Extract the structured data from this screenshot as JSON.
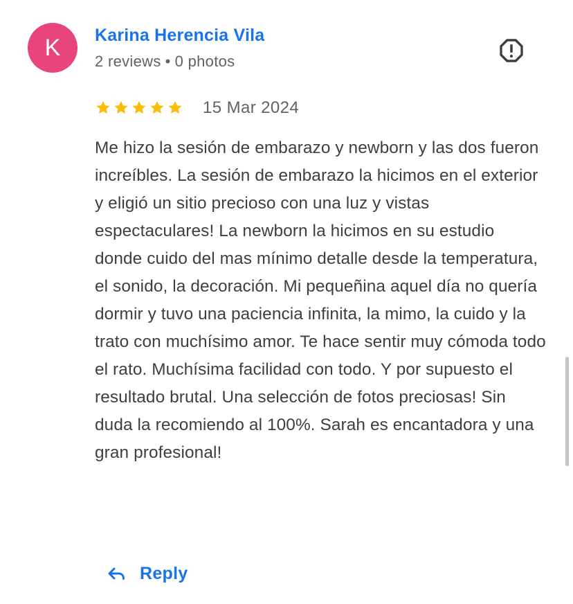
{
  "reviewer": {
    "initial": "K",
    "name": "Karina Herencia Vila",
    "reviews": "2 reviews",
    "separator": "•",
    "photos": "0 photos"
  },
  "review": {
    "rating": 5,
    "rating_max": 5,
    "date": "15 Mar 2024",
    "text": "Me hizo la sesión de embarazo y newborn y las dos fueron increíbles. La sesión de embarazo la hicimos en el exterior y eligió un sitio precioso con una luz y vistas espectaculares! La newborn la hicimos en su estudio donde cuido del mas mínimo detalle desde la temperatura, el sonido, la decoración. Mi pequeñina aquel día no quería dormir y tuvo una paciencia infinita, la mimo, la cuido y la trato con muchísimo amor. Te hace sentir muy cómoda todo el rato. Muchísima facilidad con todo. Y por supuesto el resultado brutal. Una selección de fotos preciosas! Sin duda la recomiendo al 100%. Sarah es encantadora y una gran profesional!"
  },
  "actions": {
    "reply_label": "Reply",
    "reply_icon": "reply-icon",
    "report_icon": "report-octagon-icon"
  },
  "colors": {
    "avatar_bg": "#e8457e",
    "name": "#1a73e8",
    "star": "#fbbc04",
    "accent": "#1a73e8",
    "icon": "#3c4043"
  }
}
